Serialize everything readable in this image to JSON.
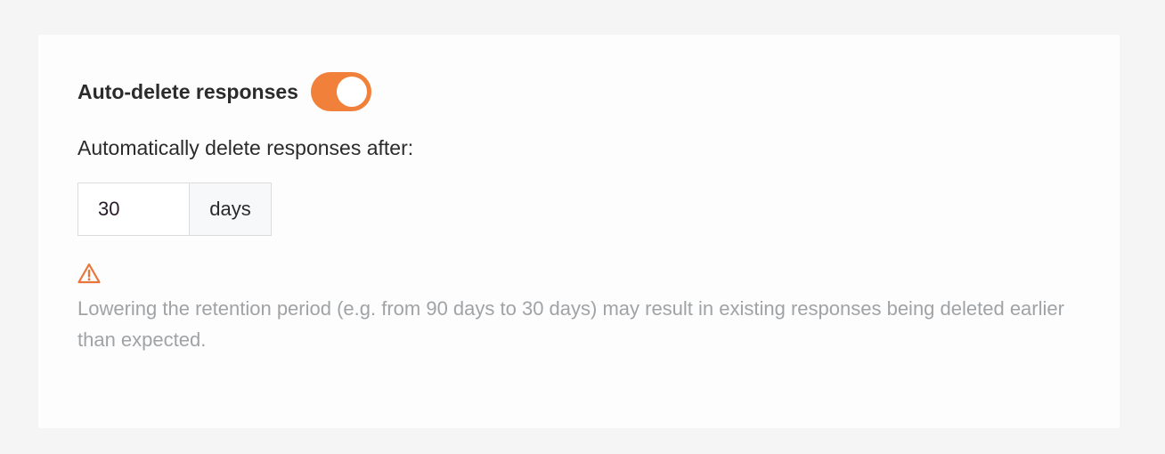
{
  "settings": {
    "auto_delete_label": "Auto-delete responses",
    "auto_delete_enabled": true,
    "retention_label": "Automatically delete responses after:",
    "retention_value": "30",
    "retention_unit": "days",
    "warning_icon": "warning-triangle-icon",
    "warning_text": "Lowering the retention period (e.g. from 90 days to 30 days) may result in existing responses being deleted earlier than expected."
  },
  "colors": {
    "accent": "#f0803a",
    "warning": "#e8763a",
    "muted_text": "#a0a3a6"
  }
}
